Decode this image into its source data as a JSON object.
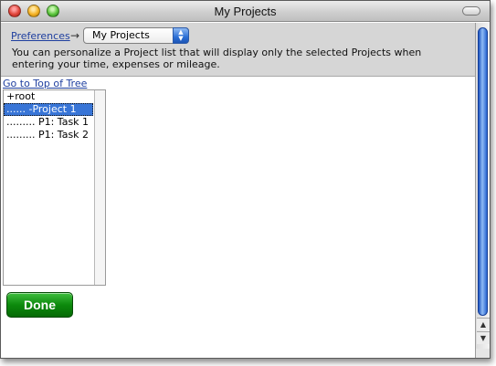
{
  "window": {
    "title": "My Projects"
  },
  "header": {
    "breadcrumb_label": "Preferences",
    "arrow": "→",
    "select_value": "My Projects",
    "description": "You can personalize a Project list that will display only the selected Projects when entering your time, expenses or mileage."
  },
  "tree": {
    "top_link": "Go to Top of Tree",
    "items": [
      {
        "label": "+root",
        "selected": false
      },
      {
        "label": "...... -Project 1",
        "selected": true
      },
      {
        "label": "......... P1: Task 1",
        "selected": false
      },
      {
        "label": "......... P1: Task 2",
        "selected": false
      }
    ]
  },
  "actions": {
    "done_label": "Done"
  },
  "colors": {
    "selection": "#3875d7",
    "done_button": "#0c8a0c",
    "link": "#1f3f9f"
  }
}
